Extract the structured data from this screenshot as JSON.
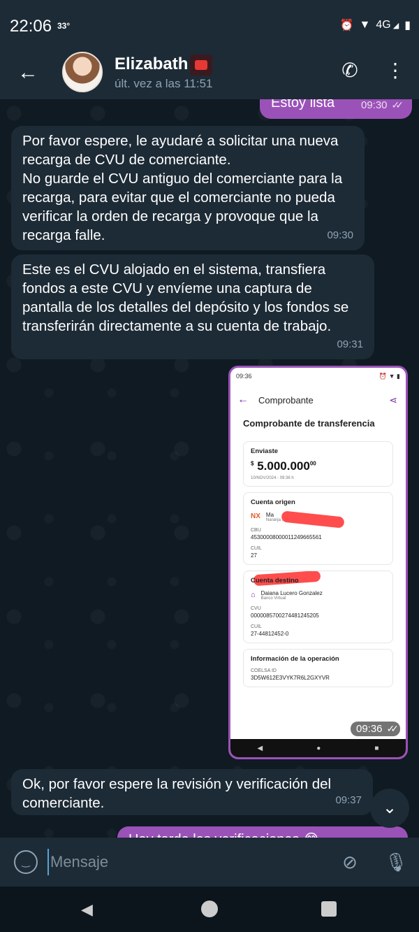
{
  "status_bar": {
    "time": "22:06",
    "temperature": "33°",
    "icons": [
      "alarm-icon",
      "wifi-icon",
      "signal-4g-icon",
      "battery-icon"
    ],
    "network": "4G"
  },
  "header": {
    "contact_name": "Elizabath",
    "last_seen": "últ. vez a las 11:51"
  },
  "messages": [
    {
      "direction": "out",
      "text": "Estoy lista",
      "time": "09:30",
      "read": true
    },
    {
      "direction": "in",
      "text": "Por favor espere, le ayudaré a solicitar una nueva recarga de CVU de comerciante.\nNo guarde el CVU antiguo del comerciante para la recarga, para evitar que el comerciante no pueda verificar la orden de recarga y provoque que la recarga falle.",
      "time": "09:30"
    },
    {
      "direction": "in",
      "text": "Este es el CVU alojado en el sistema, transfiera fondos a este CVU y envíeme una captura de pantalla de los detalles del depósito y los fondos se transferirán directamente a su cuenta de trabajo.",
      "time": "09:31"
    },
    {
      "direction": "out",
      "type": "photo",
      "time": "09:36",
      "read": true
    },
    {
      "direction": "in",
      "text": "Ok, por favor espere la revisión y verificación del comerciante.",
      "time": "09:37"
    },
    {
      "direction": "out",
      "text": "Hay tarde las verificaciones 😂",
      "partial": true
    }
  ],
  "photo": {
    "status_time": "09:36",
    "app_title": "Comprobante",
    "page_title": "Comprobante de transferencia",
    "sent_label": "Enviaste",
    "currency": "$",
    "amount": "5.000.000",
    "cents": "00",
    "date": "10/NOV/2024 - 09:36 h",
    "origin_label": "Cuenta origen",
    "origin_name": "Ma",
    "origin_bank": "Naranja X",
    "origin_logo": "NX",
    "cbu_label": "CBU",
    "cbu_value": "4530000800001124966556​1",
    "cuil_label": "CUIL",
    "cuil_value_prefix": "27",
    "dest_label": "Cuenta destino",
    "dest_name": "Daiana Lucero Gonzalez",
    "dest_bank": "Banco Virtual",
    "cvu_label": "CVU",
    "cvu_value": "0000085700274481245205",
    "dest_cuil_label": "CUIL",
    "dest_cuil_value": "27-44812452-0",
    "op_label": "Información de la operación",
    "coelsa_label": "COELSA ID",
    "coelsa_value": "3D5W612E3VYK7R6L2GXYVR"
  },
  "input": {
    "placeholder": "Mensaje"
  },
  "colors": {
    "header_bg": "#1d2b36",
    "chat_bg": "#0f1a22",
    "bubble_in": "#1d2b36",
    "bubble_out": "#9b52b8",
    "accent": "#5aa4d8"
  }
}
